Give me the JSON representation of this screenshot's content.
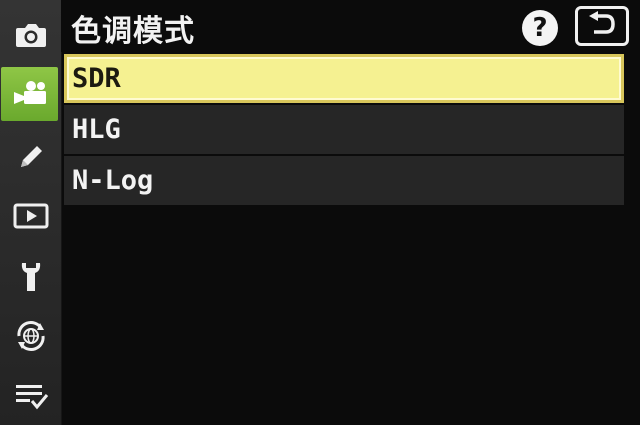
{
  "title": "色调模式",
  "help_label": "?",
  "menu": {
    "items": [
      {
        "label": "SDR",
        "selected": true
      },
      {
        "label": "HLG",
        "selected": false
      },
      {
        "label": "N-Log",
        "selected": false
      }
    ]
  },
  "sidebar": {
    "items": [
      {
        "icon": "camera-icon",
        "active": false
      },
      {
        "icon": "movie-camera-icon",
        "active": true
      },
      {
        "icon": "pencil-icon",
        "active": false
      },
      {
        "icon": "playback-icon",
        "active": false
      },
      {
        "icon": "wrench-icon",
        "active": false
      },
      {
        "icon": "network-globe-icon",
        "active": false
      },
      {
        "icon": "my-menu-icon",
        "active": false
      }
    ]
  },
  "colors": {
    "accent_green": "#7bb83a",
    "highlight_yellow": "#f5f191"
  }
}
